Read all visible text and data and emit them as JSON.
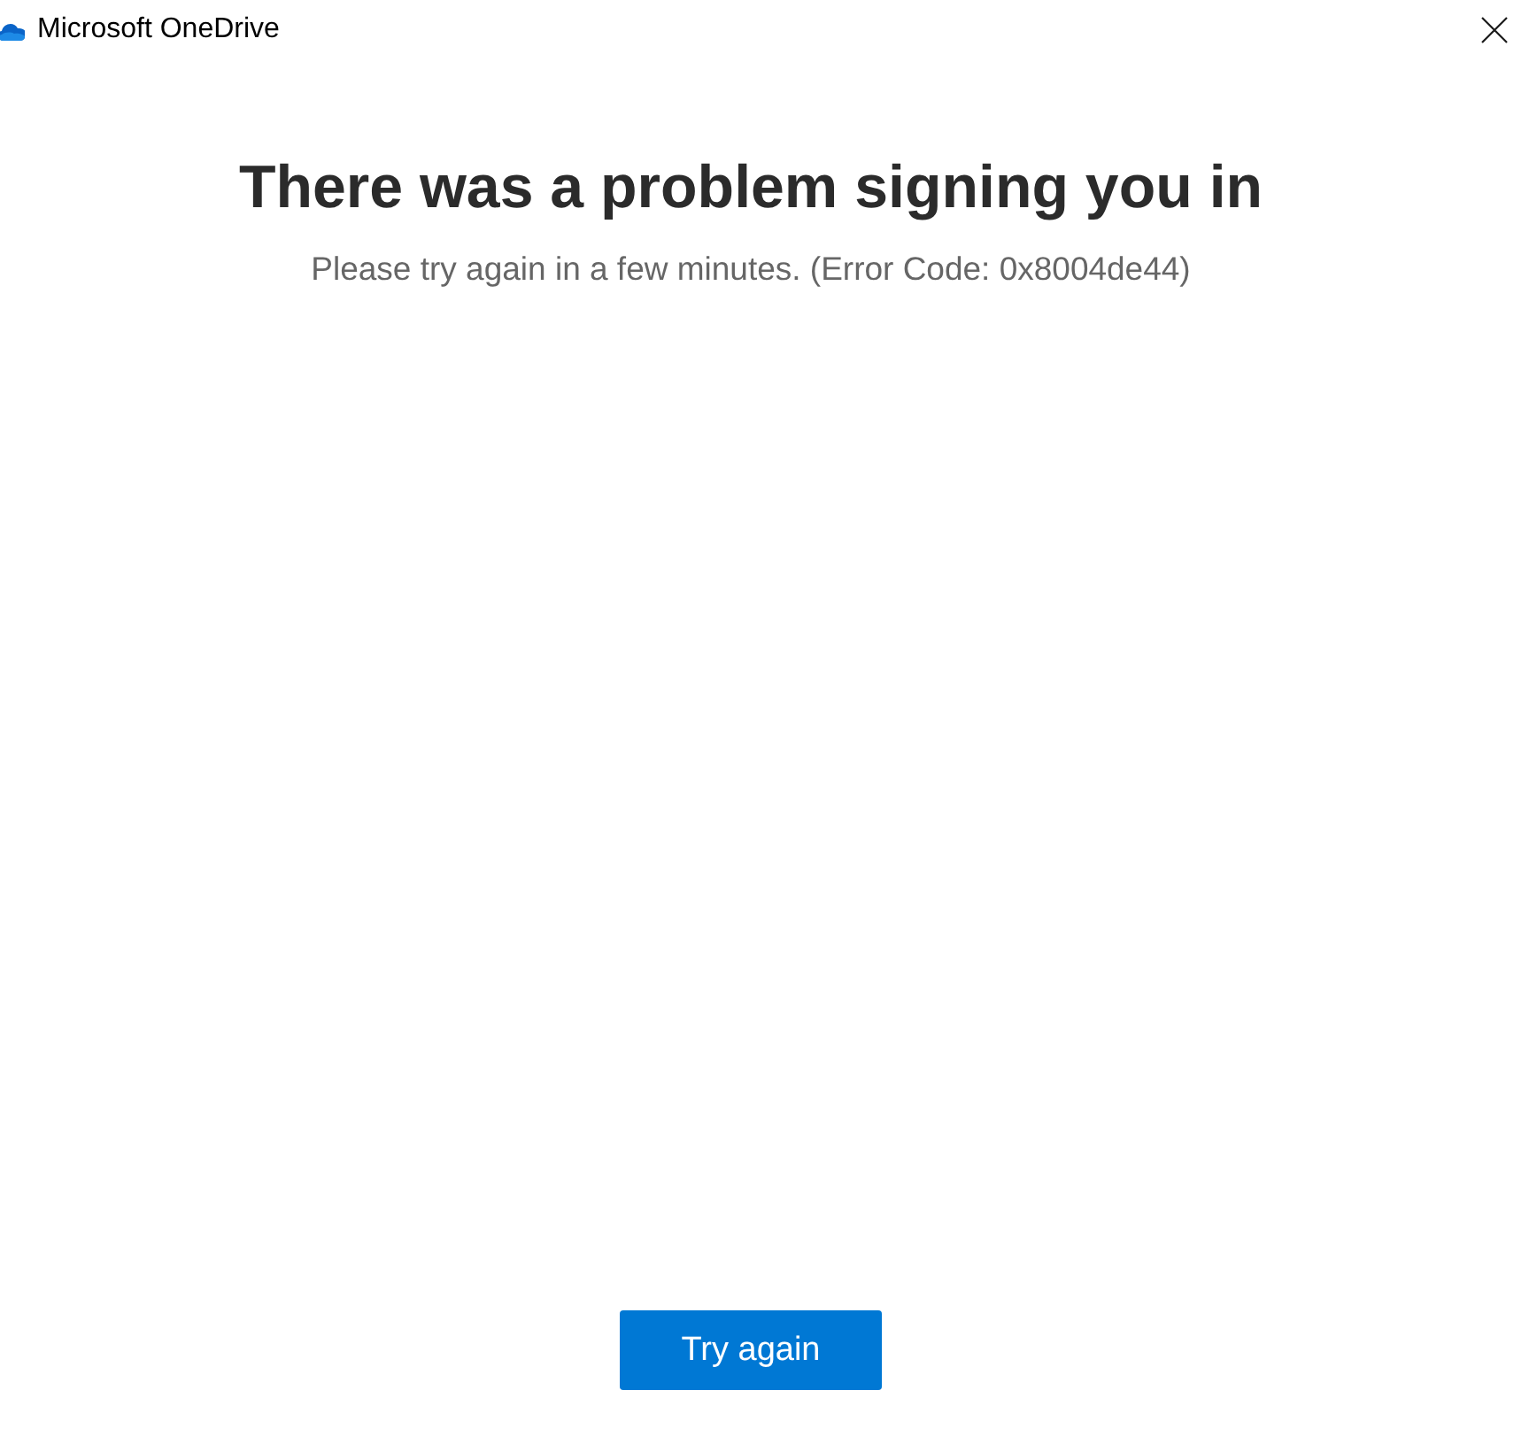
{
  "window": {
    "title": "Microsoft OneDrive"
  },
  "message": {
    "heading": "There was a problem signing you in",
    "detail": "Please try again in a few minutes. (Error Code: 0x8004de44)"
  },
  "buttons": [
    {
      "label": "Try again",
      "kind": "primary"
    }
  ]
}
